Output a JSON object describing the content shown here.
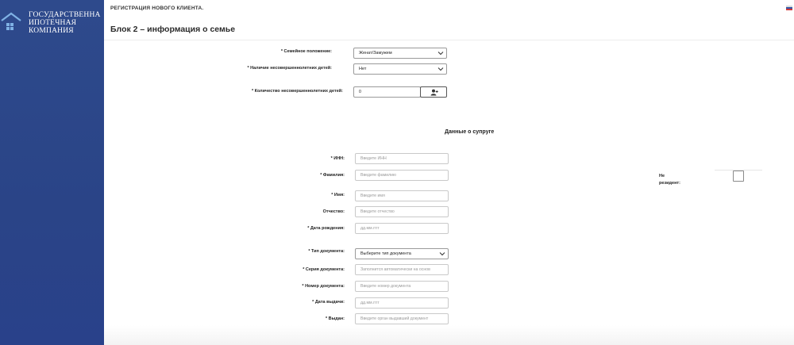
{
  "brand": {
    "logo_text": "ГОСУДАРСТВЕННА\nИПОТЕЧНАЯ\nКОМПАНИЯ",
    "color": "#2e4a8c"
  },
  "header": {
    "title": "РЕГИСТРАЦИЯ НОВОГО КЛИЕНТА.",
    "lang_icon": "russia-flag-icon"
  },
  "section": {
    "title": "Блок 2 – информация о семье"
  },
  "family": {
    "marital_label": "* Семейное положение:",
    "marital_value": "Женат/Замужем",
    "children_label": "* Наличие несовершеннолетних детей:",
    "children_value": "Нет",
    "count_label": "* Количество несовершеннолетних детей:",
    "count_value": "0",
    "add_icon": "add-user-icon"
  },
  "spouse": {
    "heading": "Данные о супруге",
    "inn_label": "* ИНН:",
    "inn_placeholder": "Введите ИНН",
    "surname_label": "* Фамилия:",
    "surname_placeholder": "Введите фамилию",
    "name_label": "* Имя:",
    "name_placeholder": "Введите имя",
    "patronymic_label": "Отчество:",
    "patronymic_placeholder": "Введите отчество",
    "birth_label": "* Дата рождения:",
    "birth_placeholder": "дд.мм.гггг",
    "nonresident_label": "Не\nрезидент:"
  },
  "document": {
    "type_label": "* Тип документа:",
    "type_value": "Выберите тип документа",
    "series_label": "* Серия документа:",
    "series_placeholder": "Заполнится автоматически на основ",
    "number_label": "* Номер документа:",
    "number_placeholder": "Введите номер документа",
    "issue_date_label": "* Дата выдачи:",
    "issue_date_placeholder": "дд.мм.гггг",
    "issued_by_label": "* Выдан:",
    "issued_by_placeholder": "Введите орган выдавший документ"
  }
}
